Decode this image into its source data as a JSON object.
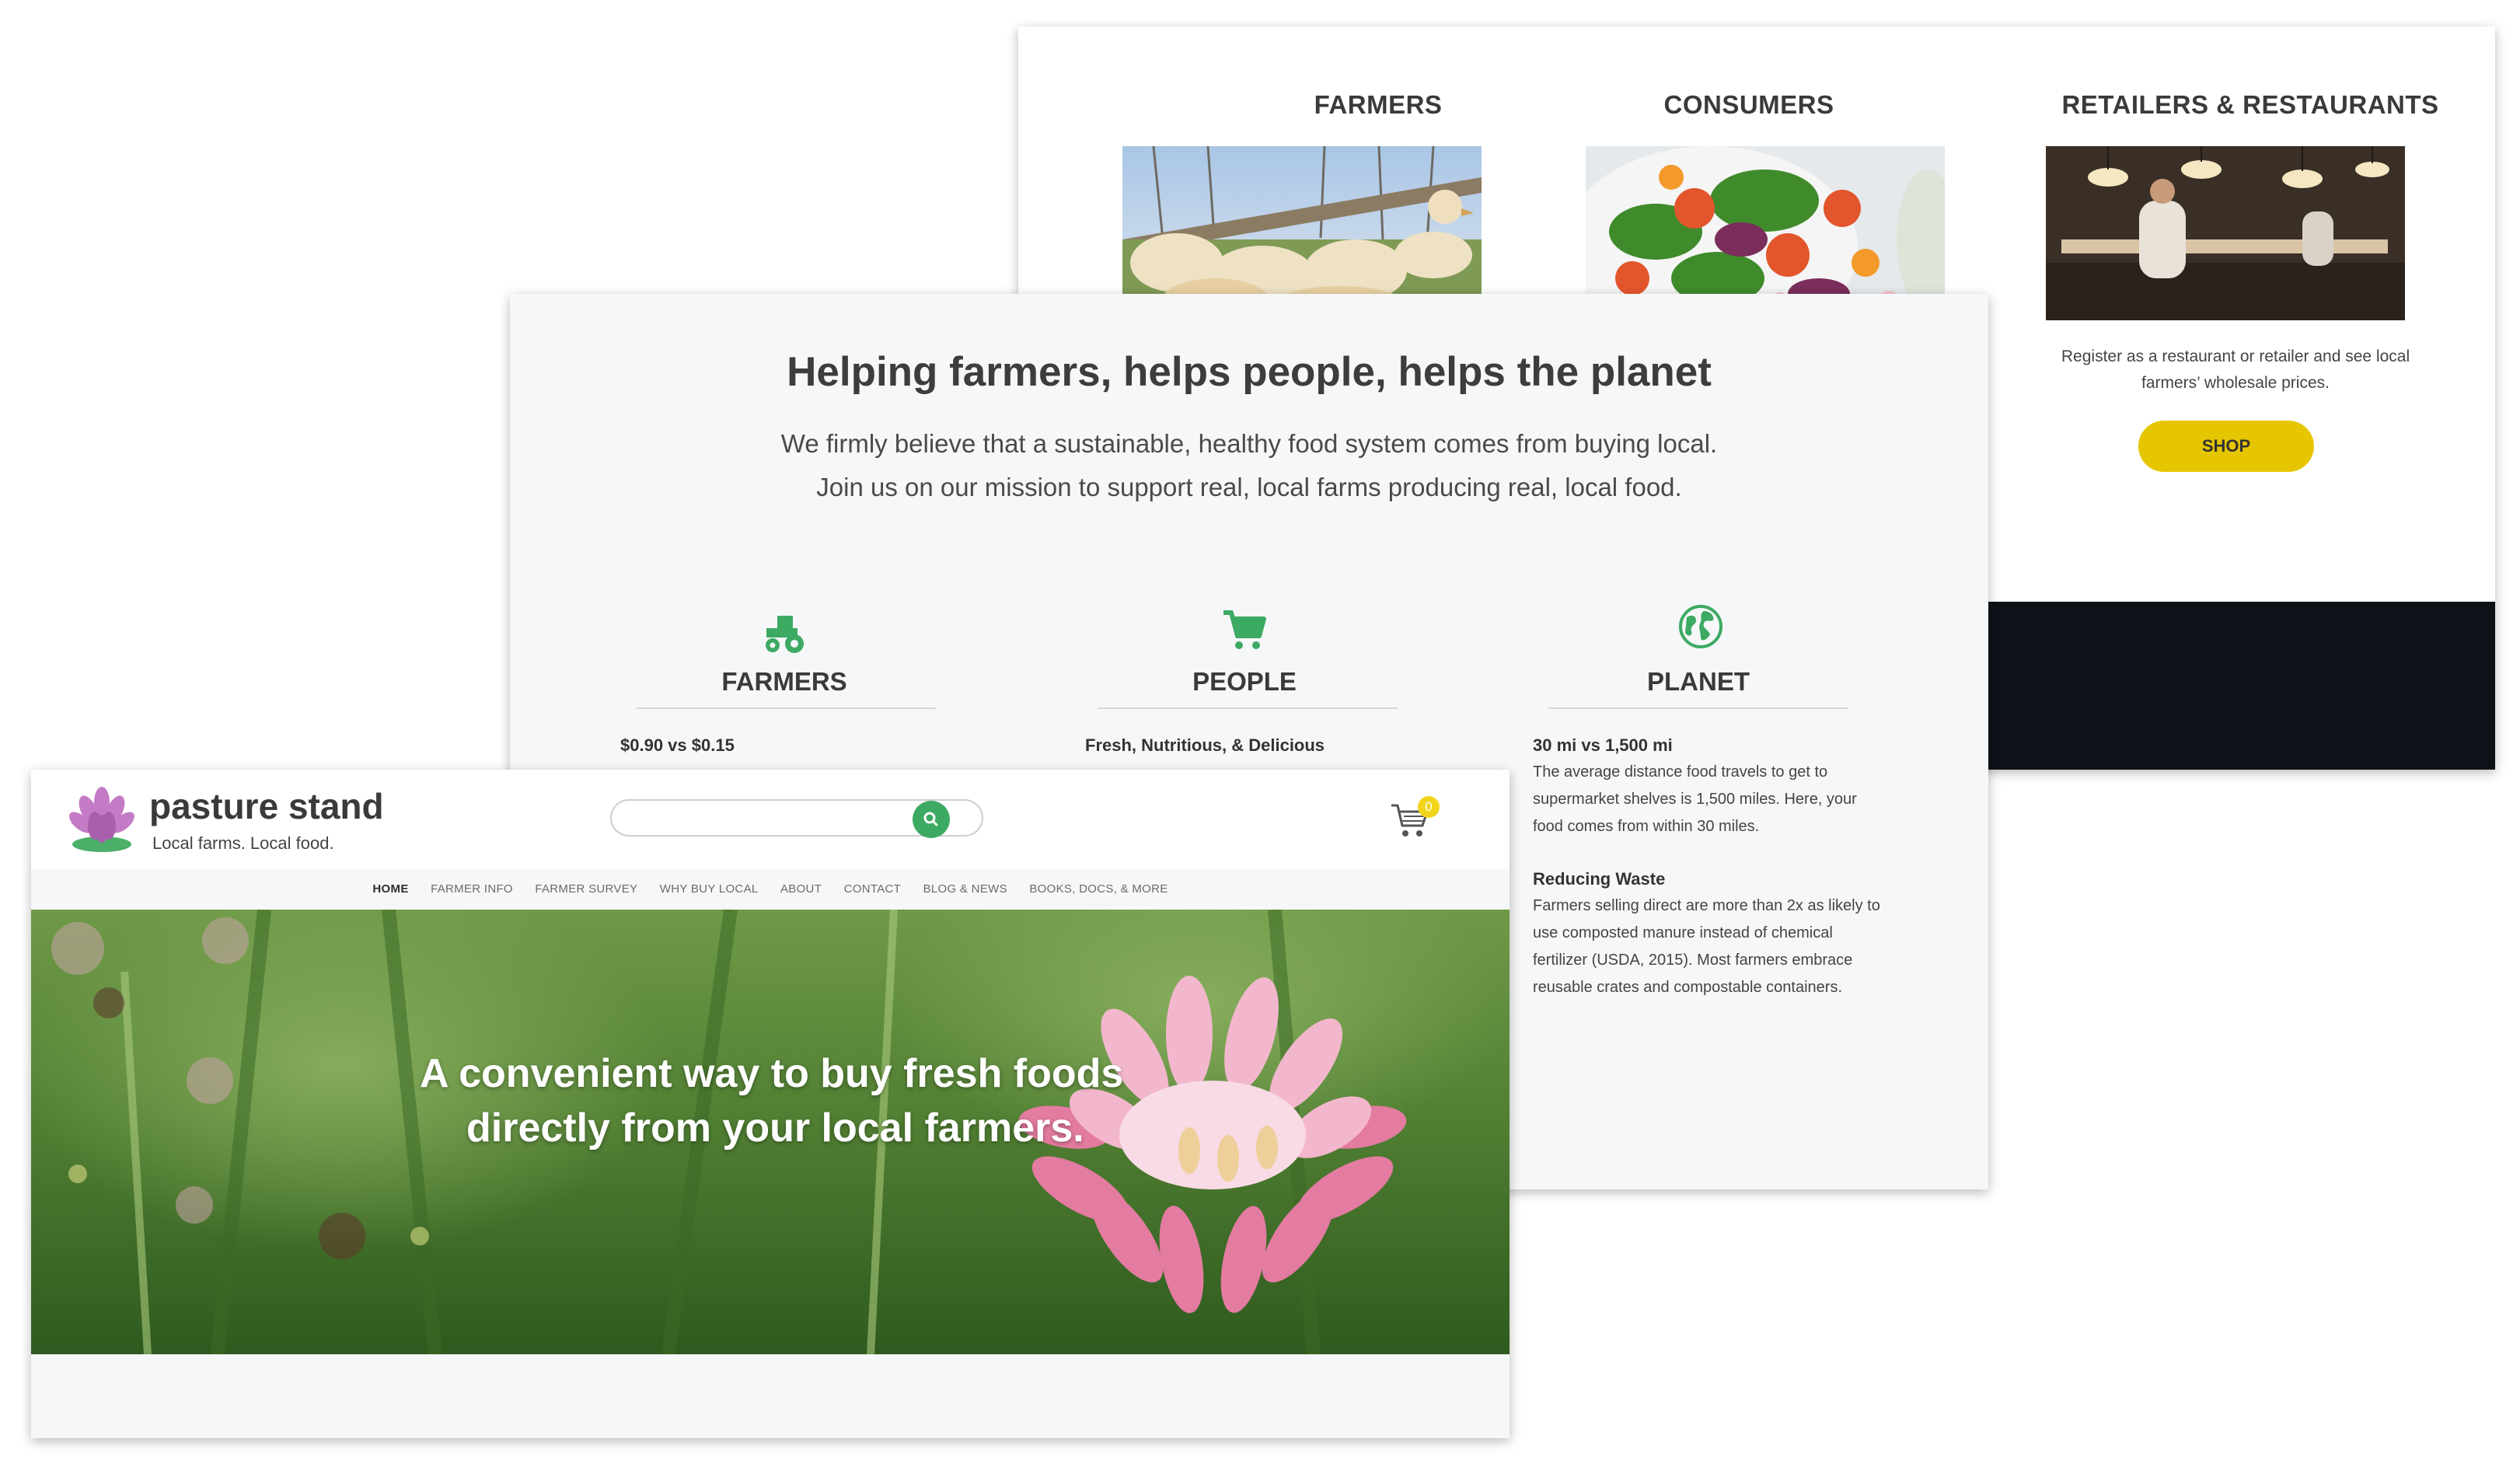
{
  "back_panel": {
    "columns": [
      {
        "title": "FARMERS"
      },
      {
        "title": "CONSUMERS"
      },
      {
        "title": "RETAILERS & RESTAURANTS"
      }
    ],
    "retail_text_line1": "Register as a restaurant or retailer and see local",
    "retail_text_line2": "farmers’ wholesale prices.",
    "shop_label": "SHOP"
  },
  "mission": {
    "headline": "Helping farmers, helps people, helps the planet",
    "line1": "We firmly believe that a sustainable, healthy food system comes from buying local.",
    "line2": "Join us on our mission to support real, local farms producing real, local food.",
    "pillars": [
      {
        "title": "FARMERS",
        "icon": "tractor-icon",
        "stat_title": "$0.90 vs $0.15"
      },
      {
        "title": "PEOPLE",
        "icon": "shopping-cart-icon",
        "stat_title": "Fresh, Nutritious, & Delicious"
      },
      {
        "title": "PLANET",
        "icon": "globe-icon",
        "stat_title": "30 mi vs 1,500 mi",
        "stat_lines": [
          "The average distance food travels to get to",
          "supermarket shelves is 1,500 miles. Here, your",
          "food comes from within 30 miles."
        ],
        "stat2_title": "Reducing Waste",
        "stat2_lines": [
          "Farmers selling direct are more than 2x as likely to",
          "use composted manure instead of chemical",
          "fertilizer (USDA, 2015). Most farmers embrace",
          "reusable crates and compostable containers."
        ]
      }
    ]
  },
  "site": {
    "brand": "pasture stand",
    "tagline": "Local farms. Local food.",
    "search_placeholder": "",
    "cart_count": "0",
    "nav": [
      {
        "label": "HOME"
      },
      {
        "label": "FARMER INFO"
      },
      {
        "label": "FARMER SURVEY"
      },
      {
        "label": "WHY BUY LOCAL"
      },
      {
        "label": "ABOUT"
      },
      {
        "label": "CONTACT"
      },
      {
        "label": "BLOG & NEWS"
      },
      {
        "label": "BOOKS, DOCS, & MORE"
      }
    ],
    "hero_line1": "A convenient way to buy fresh foods",
    "hero_line2": "directly from your local farmers."
  },
  "colors": {
    "accent_green": "#3daa63",
    "shop_yellow": "#e6c600",
    "dark_band": "#0d1218"
  }
}
